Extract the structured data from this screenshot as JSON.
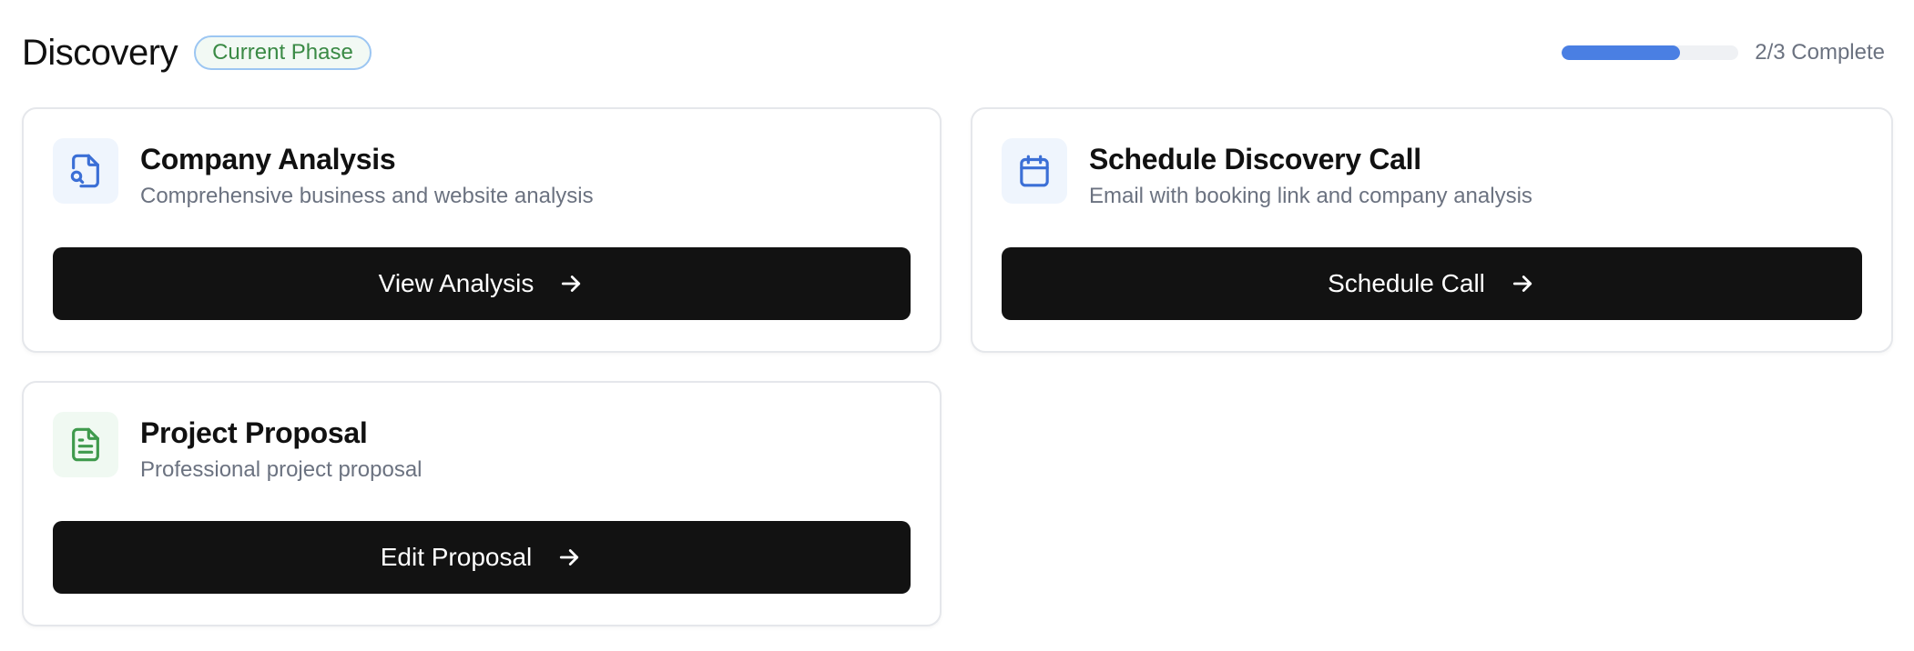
{
  "phase": {
    "title": "Discovery",
    "badge": "Current Phase",
    "progress_fraction": 0.6667,
    "progress_label": "2/3 Complete"
  },
  "colors": {
    "badge_border": "#9cc6f2",
    "badge_text": "#3a8a45",
    "progress_fill": "#4a7fe3",
    "button_bg": "#121212",
    "icon_blue": "#3b6fd6",
    "icon_green": "#3f9a4d"
  },
  "cards": [
    {
      "title": "Company Analysis",
      "description": "Comprehensive business and website analysis",
      "button_label": "View Analysis",
      "icon": "file-search-icon",
      "icon_color": "blue"
    },
    {
      "title": "Schedule Discovery Call",
      "description": "Email with booking link and company analysis",
      "button_label": "Schedule Call",
      "icon": "calendar-icon",
      "icon_color": "blue"
    },
    {
      "title": "Project Proposal",
      "description": "Professional project proposal",
      "button_label": "Edit Proposal",
      "icon": "document-icon",
      "icon_color": "green"
    }
  ]
}
